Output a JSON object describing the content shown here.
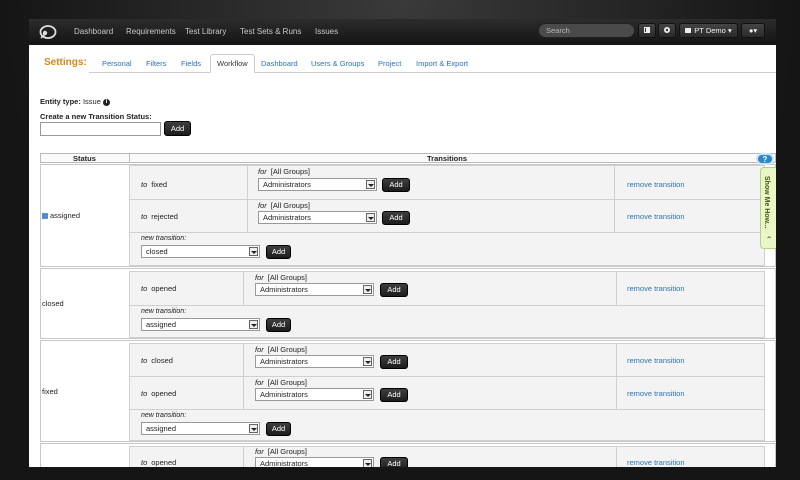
{
  "nav": {
    "items": [
      "Dashboard",
      "Requirements",
      "Test Library",
      "Test Sets & Runs",
      "Issues"
    ],
    "search_placeholder": "Search",
    "project_label": "PT Demo"
  },
  "settings": {
    "label": "Settings:",
    "tabs": [
      "Personal",
      "Filters",
      "Fields",
      "Workflow",
      "Dashboard",
      "Users & Groups",
      "Project",
      "Import & Export"
    ],
    "active_tab": "Workflow"
  },
  "entity": {
    "label": "Entity type:",
    "value": "Issue"
  },
  "create": {
    "label": "Create a new Transition Status:",
    "button": "Add"
  },
  "table": {
    "headers": {
      "status": "Status",
      "transitions": "Transitions"
    },
    "labels": {
      "to": "to",
      "for": "for",
      "all_groups": "[All Groups]",
      "add": "Add",
      "remove": "remove transition",
      "new_transition": "new transition:"
    },
    "groups": [
      {
        "status": "assigned",
        "transitions": [
          {
            "to": "fixed",
            "group": "Administrators"
          },
          {
            "to": "rejected",
            "group": "Administrators"
          }
        ],
        "new_value": "closed"
      },
      {
        "status": "closed",
        "transitions": [
          {
            "to": "opened",
            "group": "Administrators"
          }
        ],
        "new_value": "assigned"
      },
      {
        "status": "fixed",
        "transitions": [
          {
            "to": "closed",
            "group": "Administrators"
          },
          {
            "to": "opened",
            "group": "Administrators"
          }
        ],
        "new_value": "assigned"
      },
      {
        "status": "",
        "transitions": [
          {
            "to": "opened",
            "group": "Administrators"
          }
        ],
        "new_value": ""
      }
    ]
  },
  "help": {
    "question": "?",
    "show_me": "Show Me How..."
  }
}
